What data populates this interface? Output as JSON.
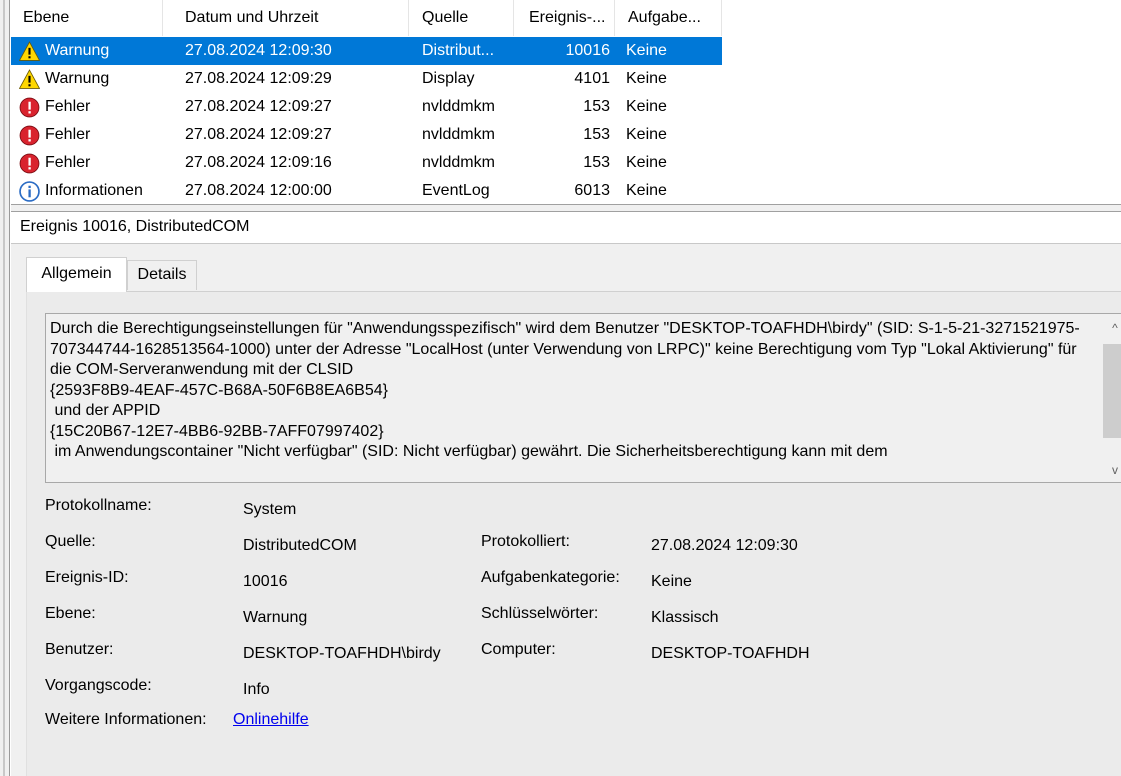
{
  "list": {
    "columns": [
      {
        "key": "ebene",
        "label": "Ebene"
      },
      {
        "key": "datum",
        "label": "Datum und Uhrzeit"
      },
      {
        "key": "quelle",
        "label": "Quelle"
      },
      {
        "key": "ereignis",
        "label": "Ereignis-..."
      },
      {
        "key": "aufgabe",
        "label": "Aufgabe..."
      }
    ],
    "rows": [
      {
        "level_icon": "warning-icon",
        "ebene": "Warnung",
        "datum": "27.08.2024 12:09:30",
        "quelle": "Distribut...",
        "ereignis": "10016",
        "aufgabe": "Keine",
        "selected": true
      },
      {
        "level_icon": "warning-icon",
        "ebene": "Warnung",
        "datum": "27.08.2024 12:09:29",
        "quelle": "Display",
        "ereignis": "4101",
        "aufgabe": "Keine",
        "selected": false
      },
      {
        "level_icon": "error-icon",
        "ebene": "Fehler",
        "datum": "27.08.2024 12:09:27",
        "quelle": "nvlddmkm",
        "ereignis": "153",
        "aufgabe": "Keine",
        "selected": false
      },
      {
        "level_icon": "error-icon",
        "ebene": "Fehler",
        "datum": "27.08.2024 12:09:27",
        "quelle": "nvlddmkm",
        "ereignis": "153",
        "aufgabe": "Keine",
        "selected": false
      },
      {
        "level_icon": "error-icon",
        "ebene": "Fehler",
        "datum": "27.08.2024 12:09:16",
        "quelle": "nvlddmkm",
        "ereignis": "153",
        "aufgabe": "Keine",
        "selected": false
      },
      {
        "level_icon": "info-icon",
        "ebene": "Informationen",
        "datum": "27.08.2024 12:00:00",
        "quelle": "EventLog",
        "ereignis": "6013",
        "aufgabe": "Keine",
        "selected": false
      }
    ]
  },
  "detail": {
    "title": "Ereignis 10016, DistributedCOM",
    "tabs": [
      {
        "label": "Allgemein",
        "active": true
      },
      {
        "label": "Details",
        "active": false
      }
    ],
    "description": "Durch die Berechtigungseinstellungen für \"Anwendungsspezifisch\" wird dem Benutzer \"DESKTOP-TOAFHDH\\birdy\" (SID: S-1-5-21-3271521975-707344744-1628513564-1000) unter der Adresse \"LocalHost (unter Verwendung von LRPC)\" keine Berechtigung vom Typ \"Lokal Aktivierung\" für die COM-Serveranwendung mit der CLSID\n{2593F8B9-4EAF-457C-B68A-50F6B8EA6B54}\n und der APPID\n{15C20B67-12E7-4BB6-92BB-7AFF07997402}\n im Anwendungscontainer \"Nicht verfügbar\" (SID: Nicht verfügbar) gewährt. Die Sicherheitsberechtigung kann mit dem",
    "scroll_up": "^",
    "scroll_down": "v",
    "properties": {
      "protokollname_label": "Protokollname:",
      "protokollname_value": "System",
      "quelle_label": "Quelle:",
      "quelle_value": "DistributedCOM",
      "protokolliert_label": "Protokolliert:",
      "protokolliert_value": "27.08.2024 12:09:30",
      "ereignisid_label": "Ereignis-ID:",
      "ereignisid_value": "10016",
      "aufgabenkategorie_label": "Aufgabenkategorie:",
      "aufgabenkategorie_value": "Keine",
      "ebene_label": "Ebene:",
      "ebene_value": "Warnung",
      "schluesselwoerter_label": "Schlüsselwörter:",
      "schluesselwoerter_value": "Klassisch",
      "benutzer_label": "Benutzer:",
      "benutzer_value": "DESKTOP-TOAFHDH\\birdy",
      "computer_label": "Computer:",
      "computer_value": "DESKTOP-TOAFHDH",
      "vorgangscode_label": "Vorgangscode:",
      "vorgangscode_value": "Info",
      "weitere_label": "Weitere Informationen:",
      "weitere_link": "Onlinehilfe"
    }
  },
  "colors": {
    "selection": "#0078d7",
    "warning": "#ffd700",
    "error": "#d9232e",
    "info": "#2b6cc4",
    "link": "#0000ee"
  }
}
